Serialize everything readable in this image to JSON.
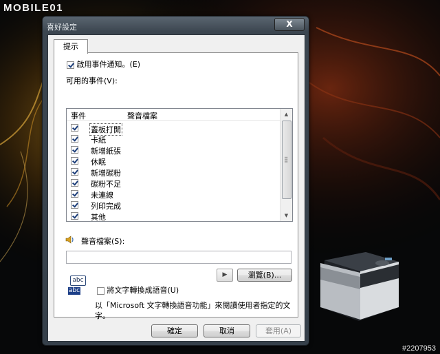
{
  "site": {
    "logo": "MOBILE01",
    "watermark": "#2207953"
  },
  "window": {
    "title": "喜好設定",
    "close_label": "X"
  },
  "tabs": [
    {
      "label": "提示",
      "selected": true
    }
  ],
  "enable_notification": {
    "label": "啟用事件通知。(E)",
    "checked": true
  },
  "events": {
    "label": "可用的事件(V):",
    "columns": [
      "事件",
      "聲音檔案"
    ],
    "items": [
      {
        "name": "蓋板打開",
        "checked": true,
        "selected": true
      },
      {
        "name": "卡紙",
        "checked": true
      },
      {
        "name": "新增紙張",
        "checked": true
      },
      {
        "name": "休眠",
        "checked": true
      },
      {
        "name": "新增碳粉",
        "checked": true
      },
      {
        "name": "碳粉不足",
        "checked": true
      },
      {
        "name": "未連線",
        "checked": true
      },
      {
        "name": "列印完成",
        "checked": true
      },
      {
        "name": "其他",
        "checked": true
      }
    ]
  },
  "sound_file": {
    "label": "聲音檔案(S):",
    "value": ""
  },
  "play_icon": "play-triangle-icon",
  "browse_button": "瀏覽(B)...",
  "tts": {
    "icon_top": "abc",
    "icon_bottom": "abc",
    "label": "將文字轉換成語音(U)",
    "checked": false,
    "description": "以「Microsoft 文字轉換語音功能」來閱讀使用者指定的文字。"
  },
  "footer": {
    "ok": "確定",
    "cancel": "取消",
    "apply": "套用(A)"
  },
  "colors": {
    "accent": "#1d3f88",
    "window_frame": "#3c4650"
  }
}
